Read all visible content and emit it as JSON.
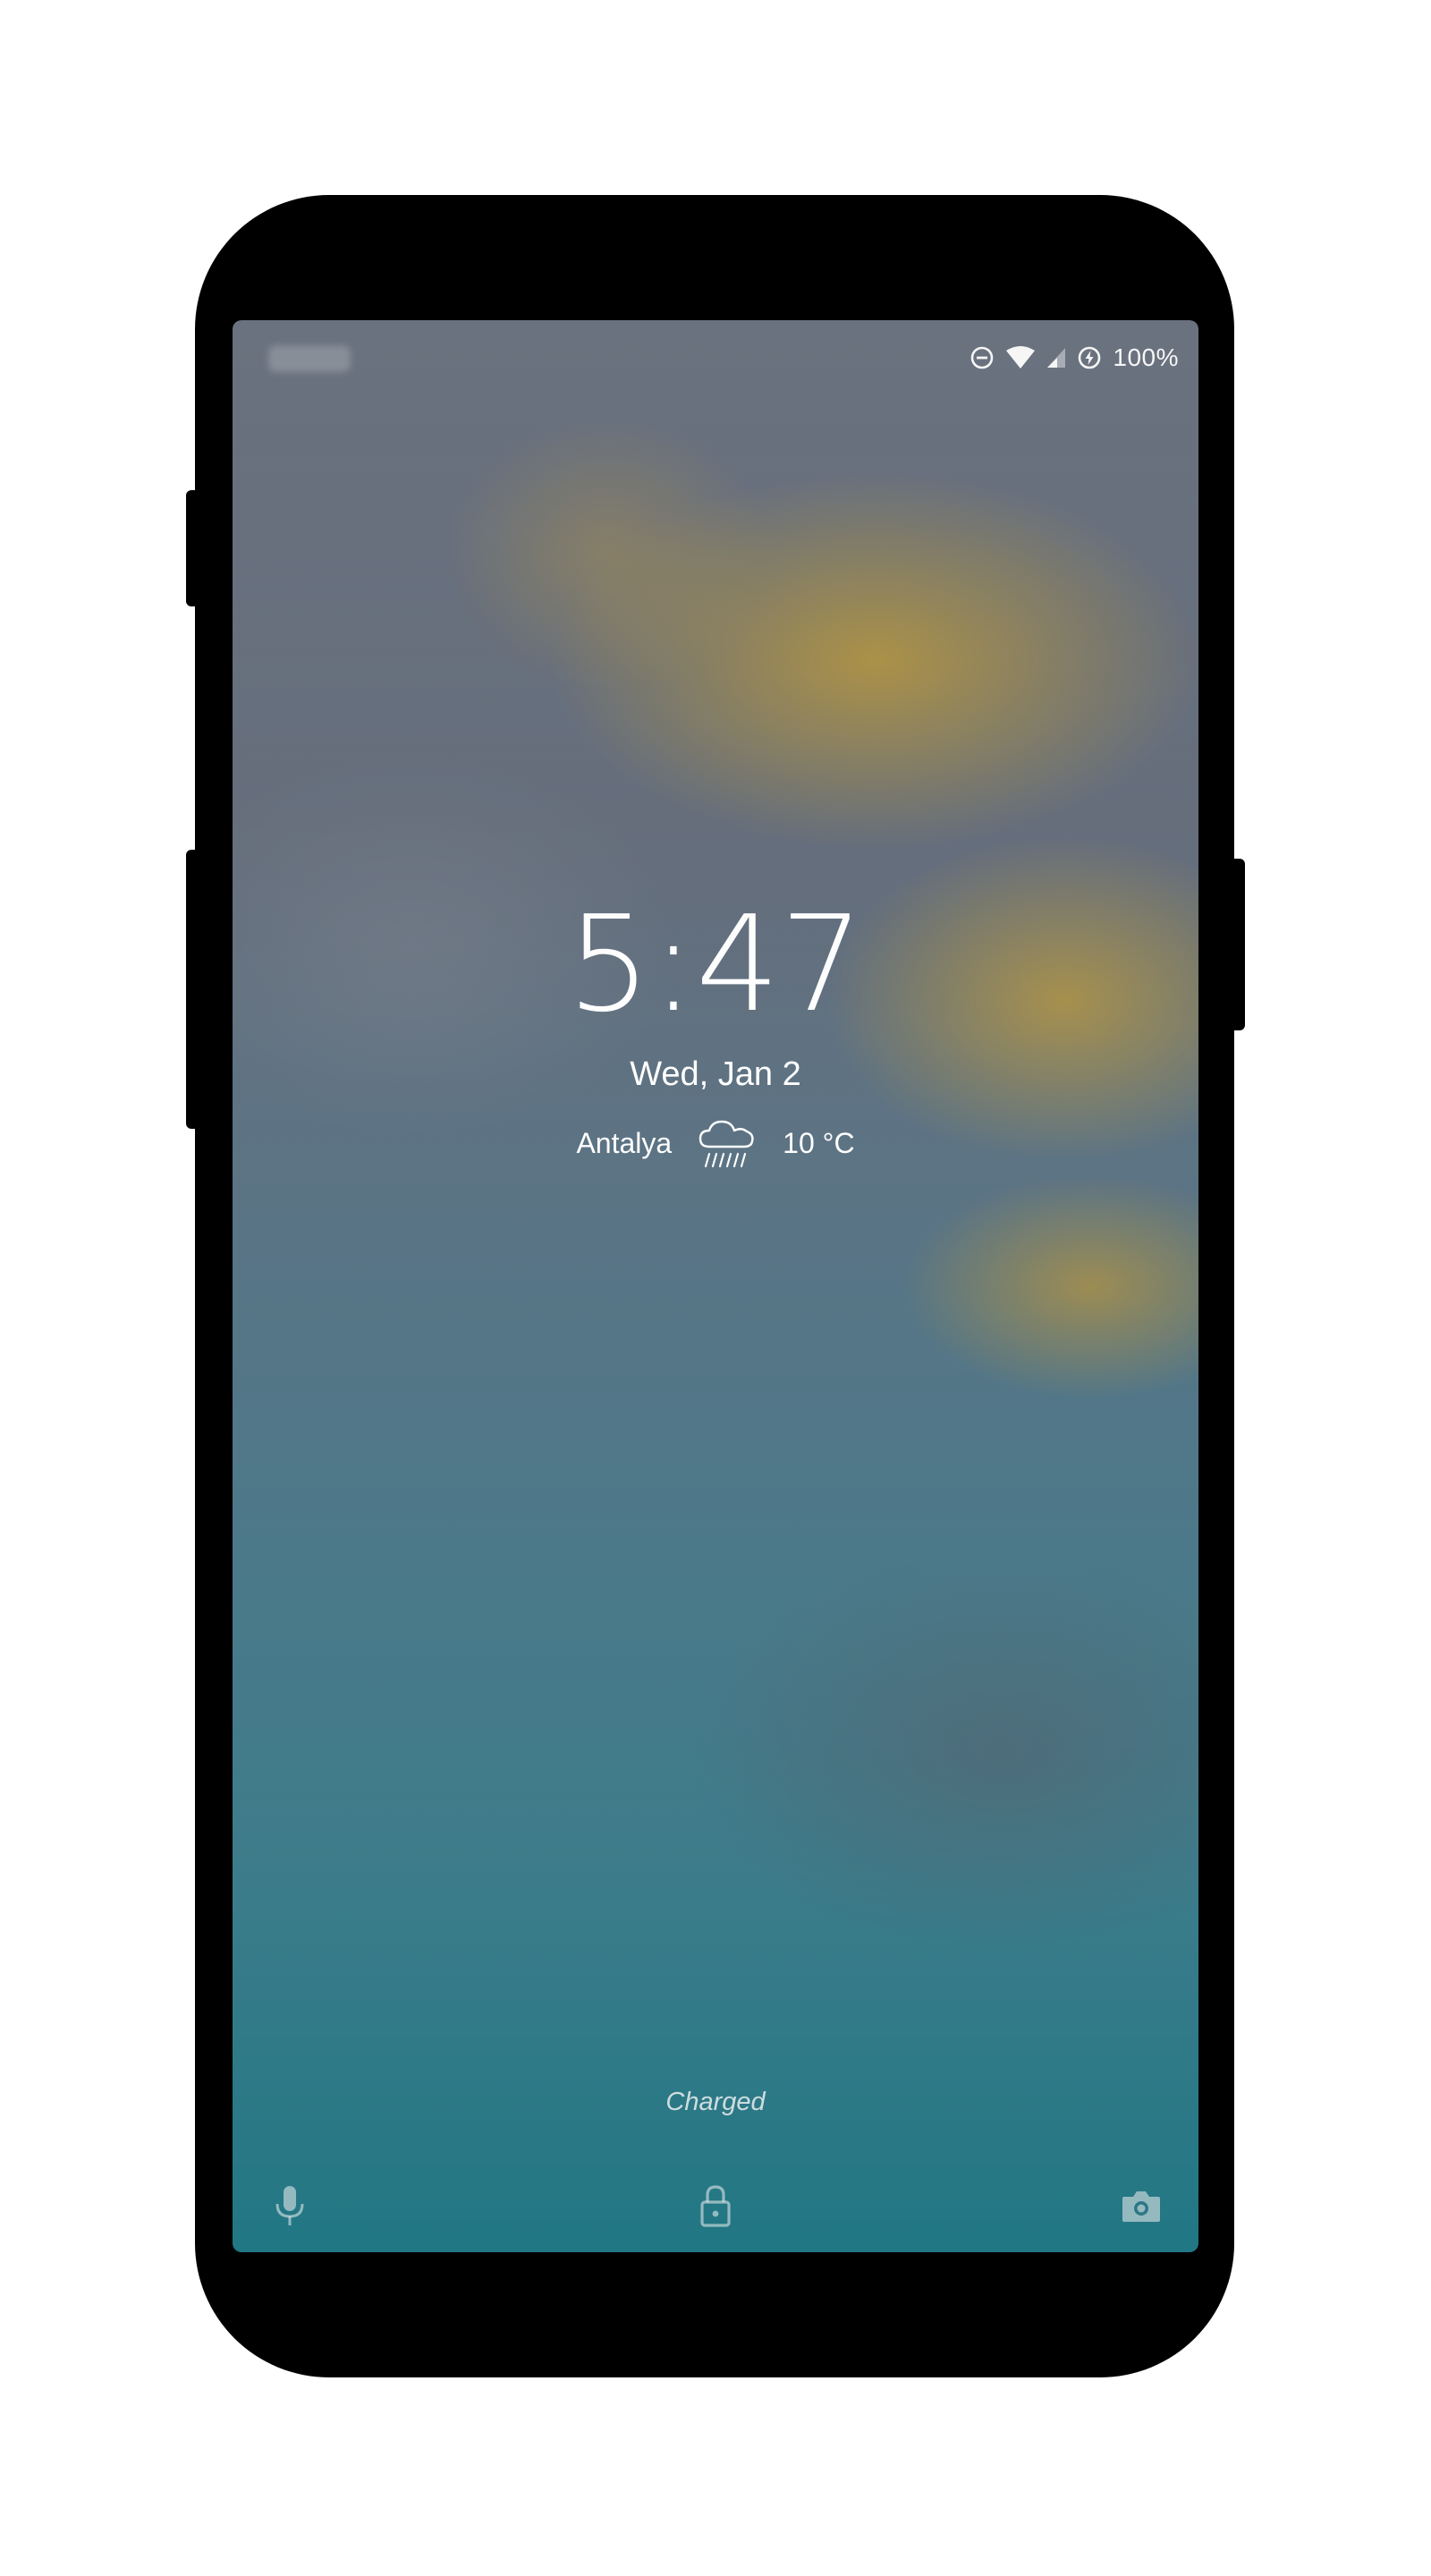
{
  "status_bar": {
    "battery_percent": "100%",
    "icons": [
      "do-not-disturb-icon",
      "wifi-icon",
      "cell-signal-icon",
      "battery-charging-icon"
    ]
  },
  "lockscreen": {
    "time": "5:47",
    "date": "Wed, Jan 2",
    "weather": {
      "city": "Antalya",
      "temperature": "10 °C",
      "icon": "rain-cloud-icon"
    },
    "charging_status": "Charged"
  },
  "bottom_actions": {
    "left": "microphone-icon",
    "center": "unlock-icon",
    "right": "camera-icon"
  },
  "colors": {
    "text": "#ffffff",
    "device_frame": "#000000",
    "wallpaper_gold": "#b39646",
    "wallpaper_teal": "#237e8c"
  }
}
